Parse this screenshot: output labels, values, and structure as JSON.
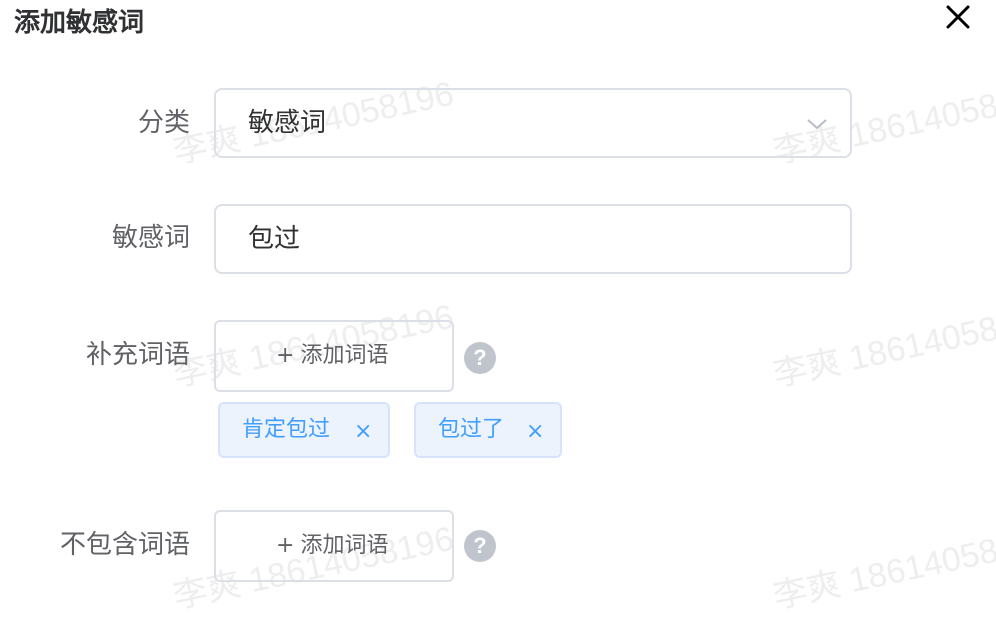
{
  "dialog": {
    "title": "添加敏感词"
  },
  "watermark_text": "李爽 18614058196",
  "form": {
    "category": {
      "label": "分类",
      "value": "敏感词"
    },
    "sensitive_word": {
      "label": "敏感词",
      "value": "包过"
    },
    "supplement_words": {
      "label": "补充词语",
      "add_button_label": "添加词语",
      "tags": [
        {
          "text": "肯定包过",
          "close": "×"
        },
        {
          "text": "包过了",
          "close": "×"
        }
      ]
    },
    "exclude_words": {
      "label": "不包含词语",
      "add_button_label": "添加词语"
    }
  },
  "icons": {
    "close": "close-icon",
    "arrow": "chevron-down-icon",
    "help": "question-circle-icon",
    "plus": "plus-icon"
  },
  "colors": {
    "tag_text": "#409eff",
    "tag_bg": "#ecf3fd",
    "border": "#dcdfe6",
    "help_icon": "#c0c4cc"
  }
}
